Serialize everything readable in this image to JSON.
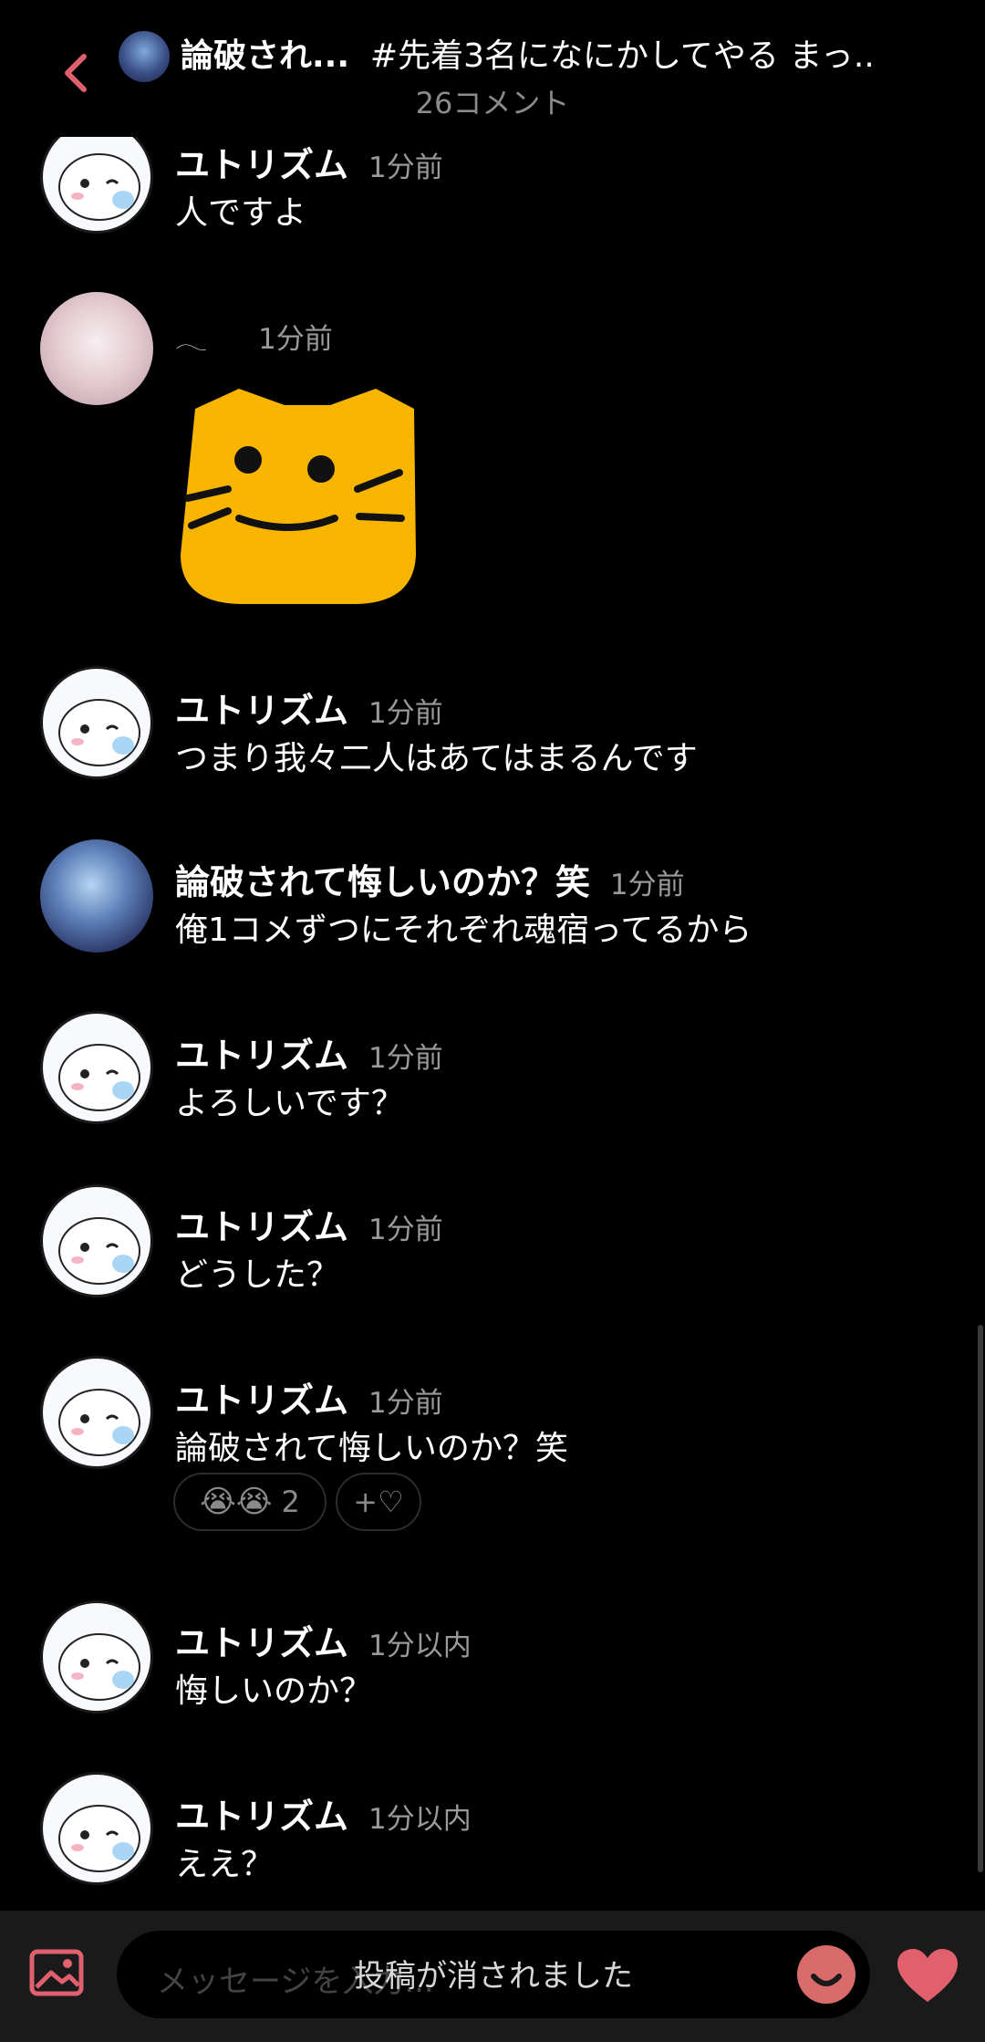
{
  "header": {
    "author": "論破され...",
    "title": "#先着3名になにかしてやる まっ...",
    "comment_count": "26コメント"
  },
  "comments": [
    {
      "name": "ユトリズム",
      "time": "1分前",
      "text": "人ですよ"
    },
    {
      "name": "𓂃",
      "time": "1分前",
      "sticker": "cat-face-sticker"
    },
    {
      "name": "ユトリズム",
      "time": "1分前",
      "text": "つまり我々二人はあてはまるんです"
    },
    {
      "name": "論破されて悔しいのか？笑",
      "time": "1分前",
      "text": "俺1コメずつにそれぞれ魂宿ってるから"
    },
    {
      "name": "ユトリズム",
      "time": "1分前",
      "text": "よろしいです？"
    },
    {
      "name": "ユトリズム",
      "time": "1分前",
      "text": "どうした？"
    },
    {
      "name": "ユトリズム",
      "time": "1分前",
      "text": "論破されて悔しいのか？笑",
      "reaction": {
        "emoji": "😭😭",
        "count": "2",
        "add_label": "+♡"
      }
    },
    {
      "name": "ユトリズム",
      "time": "1分以内",
      "text": "悔しいのか？"
    },
    {
      "name": "ユトリズム",
      "time": "1分以内",
      "text": "ええ？"
    }
  ],
  "footer": {
    "placeholder": "メッセージを入力...",
    "toast": "投稿が消されました"
  },
  "colors": {
    "accent": "#e0606e",
    "background": "#000000",
    "muted": "#9a9a9a",
    "sticker": "#f7b500"
  }
}
